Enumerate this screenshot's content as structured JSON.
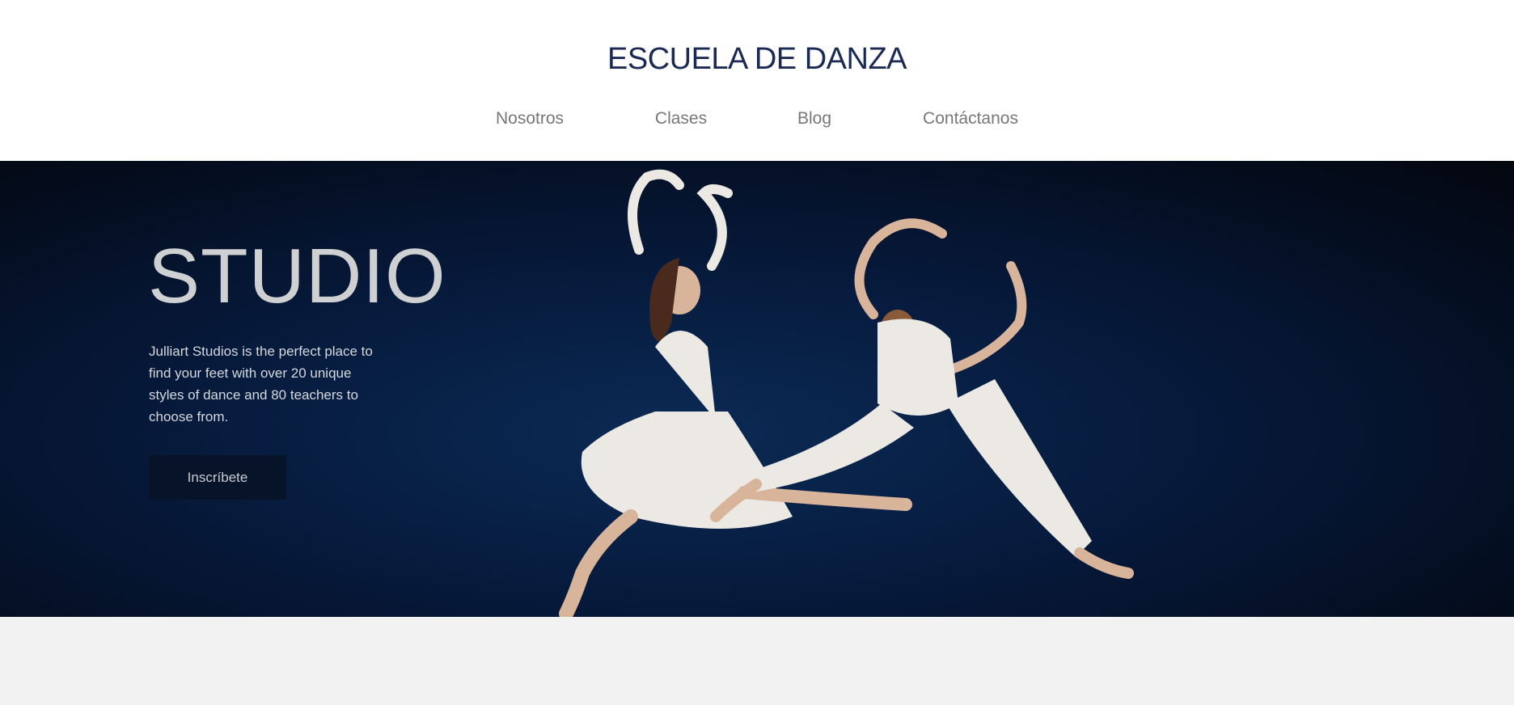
{
  "header": {
    "title": "ESCUELA DE DANZA",
    "nav": [
      "Nosotros",
      "Clases",
      "Blog",
      "Contáctanos"
    ]
  },
  "hero": {
    "title": "STUDIO",
    "description": "Julliart Studios is the perfect place to find your feet with over 20 unique styles of dance and 80 teachers to choose from.",
    "button_label": "Inscríbete"
  },
  "colors": {
    "title": "#1b2a55",
    "nav": "#777777",
    "hero_bg": "#06193a",
    "button_bg": "#061328"
  }
}
